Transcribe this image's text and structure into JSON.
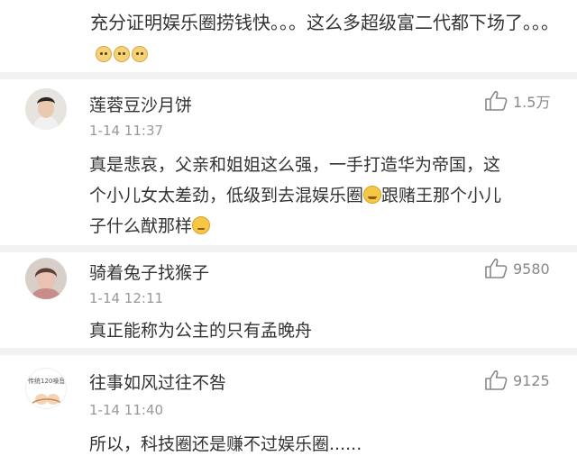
{
  "top_comment": {
    "text": "充分证明娱乐圈捞钱快。。。这么多超级富二代都下场了。。。",
    "emoji_count": 3,
    "emoji_icon": "doge-emoji"
  },
  "comments": [
    {
      "username": "莲蓉豆沙月饼",
      "time": "1-14 11:37",
      "likes": "1.5万",
      "text_lines": [
        "真是悲哀，父亲和姐姐这么强，一手打造华为帝国，这",
        "个小儿女太差劲，低级到去混娱乐圈",
        "跟赌王那个小儿",
        "子什么猷那样"
      ]
    },
    {
      "username": "骑着兔子找猴子",
      "time": "1-14 12:11",
      "likes": "9580",
      "text_lines": [
        "真正能称为公主的只有孟晚舟"
      ]
    },
    {
      "username": "往事如风过往不咎",
      "time": "1-14 11:40",
      "likes": "9125",
      "avatar_text": "传统120噪音",
      "text_lines": [
        "所以，科技圈还是赚不过娱乐圈......"
      ]
    }
  ],
  "colors": {
    "text": "#333333",
    "muted": "#999999",
    "divider": "#f2f2f2",
    "like": "#888888"
  }
}
